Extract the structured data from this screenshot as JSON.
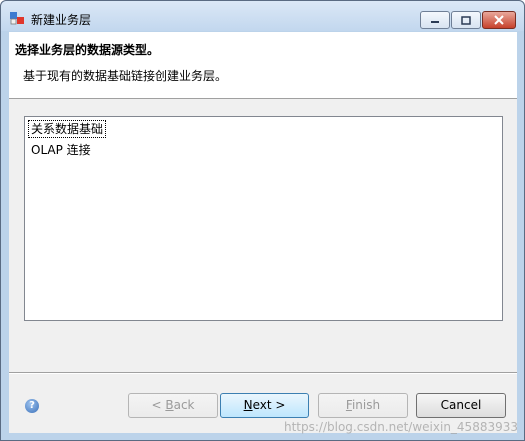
{
  "window": {
    "title": "新建业务层"
  },
  "header": {
    "title": "选择业务层的数据源类型。",
    "description": "基于现有的数据基础链接创建业务层。"
  },
  "list": {
    "items": [
      {
        "label": "关系数据基础",
        "selected": true
      },
      {
        "label": "OLAP 连接",
        "selected": false
      }
    ]
  },
  "buttons": {
    "back": {
      "prefix": "< ",
      "mnemonic": "B",
      "rest": "ack",
      "enabled": false
    },
    "next": {
      "mnemonic": "N",
      "rest": "ext >",
      "enabled": true
    },
    "finish": {
      "mnemonic": "F",
      "rest": "inish",
      "enabled": false
    },
    "cancel": {
      "label": "Cancel",
      "enabled": true
    }
  },
  "watermark": "https://blog.csdn.net/weixin_45883933",
  "colors": {
    "accent": "#3c7fb1",
    "close_button": "#c7412b"
  }
}
